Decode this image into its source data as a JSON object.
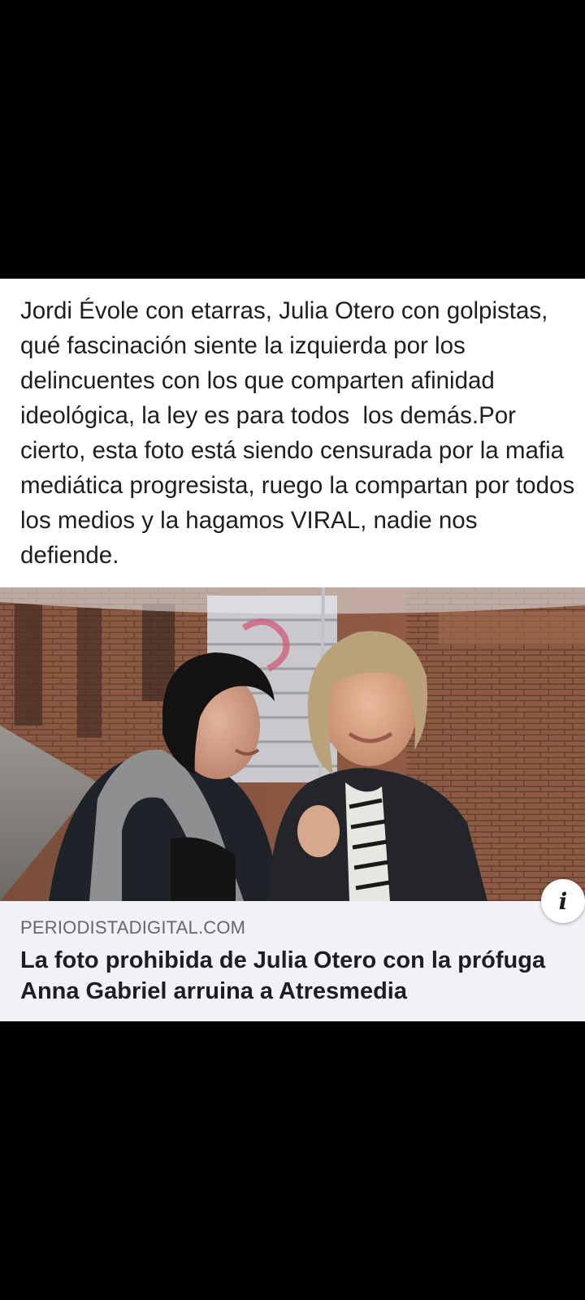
{
  "post": {
    "text": "Jordi Évole con etarras, Julia Otero con golpistas, qué fascinación siente la izquierda por los delincuentes con los que comparten afinidad ideológica, la ley es para todos  los demás.Por cierto, esta foto está siendo censurada por la mafia mediática progresista, ruego la compartan por todos los medios y la hagamos VIRAL, nadie nos defiende."
  },
  "link": {
    "domain": "PERIODISTADIGITAL.COM",
    "title": "La foto prohibida de Julia Otero con la prófuga Anna Gabriel arruina a Atresmedia",
    "info_icon": "info-icon",
    "info_glyph": "i"
  },
  "colors": {
    "background": "#000000",
    "card": "#ffffff",
    "caption_bg": "#f0f2f5",
    "text_primary": "#1c1e21",
    "text_secondary": "#65676b"
  }
}
